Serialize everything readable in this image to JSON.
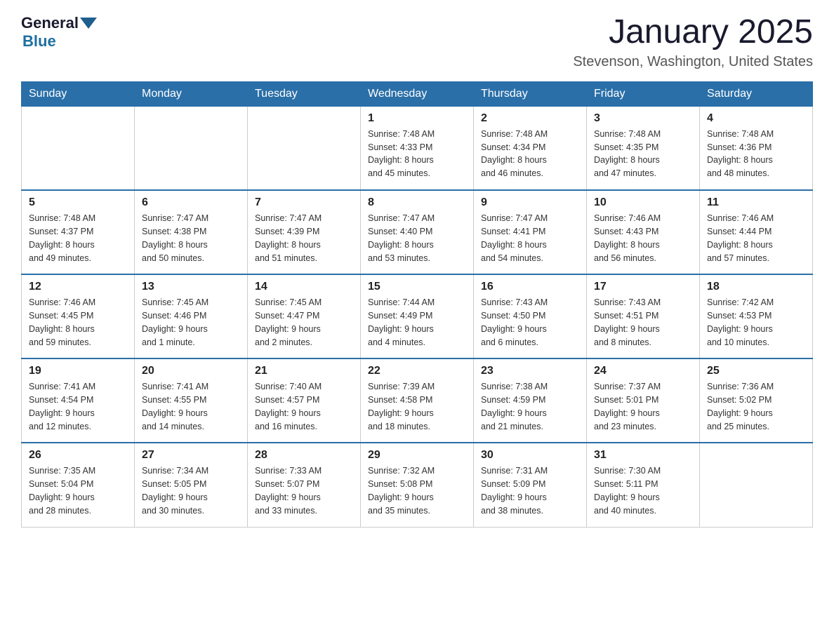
{
  "logo": {
    "general": "General",
    "blue": "Blue"
  },
  "title": "January 2025",
  "location": "Stevenson, Washington, United States",
  "days_of_week": [
    "Sunday",
    "Monday",
    "Tuesday",
    "Wednesday",
    "Thursday",
    "Friday",
    "Saturday"
  ],
  "weeks": [
    [
      {
        "day": "",
        "info": ""
      },
      {
        "day": "",
        "info": ""
      },
      {
        "day": "",
        "info": ""
      },
      {
        "day": "1",
        "info": "Sunrise: 7:48 AM\nSunset: 4:33 PM\nDaylight: 8 hours\nand 45 minutes."
      },
      {
        "day": "2",
        "info": "Sunrise: 7:48 AM\nSunset: 4:34 PM\nDaylight: 8 hours\nand 46 minutes."
      },
      {
        "day": "3",
        "info": "Sunrise: 7:48 AM\nSunset: 4:35 PM\nDaylight: 8 hours\nand 47 minutes."
      },
      {
        "day": "4",
        "info": "Sunrise: 7:48 AM\nSunset: 4:36 PM\nDaylight: 8 hours\nand 48 minutes."
      }
    ],
    [
      {
        "day": "5",
        "info": "Sunrise: 7:48 AM\nSunset: 4:37 PM\nDaylight: 8 hours\nand 49 minutes."
      },
      {
        "day": "6",
        "info": "Sunrise: 7:47 AM\nSunset: 4:38 PM\nDaylight: 8 hours\nand 50 minutes."
      },
      {
        "day": "7",
        "info": "Sunrise: 7:47 AM\nSunset: 4:39 PM\nDaylight: 8 hours\nand 51 minutes."
      },
      {
        "day": "8",
        "info": "Sunrise: 7:47 AM\nSunset: 4:40 PM\nDaylight: 8 hours\nand 53 minutes."
      },
      {
        "day": "9",
        "info": "Sunrise: 7:47 AM\nSunset: 4:41 PM\nDaylight: 8 hours\nand 54 minutes."
      },
      {
        "day": "10",
        "info": "Sunrise: 7:46 AM\nSunset: 4:43 PM\nDaylight: 8 hours\nand 56 minutes."
      },
      {
        "day": "11",
        "info": "Sunrise: 7:46 AM\nSunset: 4:44 PM\nDaylight: 8 hours\nand 57 minutes."
      }
    ],
    [
      {
        "day": "12",
        "info": "Sunrise: 7:46 AM\nSunset: 4:45 PM\nDaylight: 8 hours\nand 59 minutes."
      },
      {
        "day": "13",
        "info": "Sunrise: 7:45 AM\nSunset: 4:46 PM\nDaylight: 9 hours\nand 1 minute."
      },
      {
        "day": "14",
        "info": "Sunrise: 7:45 AM\nSunset: 4:47 PM\nDaylight: 9 hours\nand 2 minutes."
      },
      {
        "day": "15",
        "info": "Sunrise: 7:44 AM\nSunset: 4:49 PM\nDaylight: 9 hours\nand 4 minutes."
      },
      {
        "day": "16",
        "info": "Sunrise: 7:43 AM\nSunset: 4:50 PM\nDaylight: 9 hours\nand 6 minutes."
      },
      {
        "day": "17",
        "info": "Sunrise: 7:43 AM\nSunset: 4:51 PM\nDaylight: 9 hours\nand 8 minutes."
      },
      {
        "day": "18",
        "info": "Sunrise: 7:42 AM\nSunset: 4:53 PM\nDaylight: 9 hours\nand 10 minutes."
      }
    ],
    [
      {
        "day": "19",
        "info": "Sunrise: 7:41 AM\nSunset: 4:54 PM\nDaylight: 9 hours\nand 12 minutes."
      },
      {
        "day": "20",
        "info": "Sunrise: 7:41 AM\nSunset: 4:55 PM\nDaylight: 9 hours\nand 14 minutes."
      },
      {
        "day": "21",
        "info": "Sunrise: 7:40 AM\nSunset: 4:57 PM\nDaylight: 9 hours\nand 16 minutes."
      },
      {
        "day": "22",
        "info": "Sunrise: 7:39 AM\nSunset: 4:58 PM\nDaylight: 9 hours\nand 18 minutes."
      },
      {
        "day": "23",
        "info": "Sunrise: 7:38 AM\nSunset: 4:59 PM\nDaylight: 9 hours\nand 21 minutes."
      },
      {
        "day": "24",
        "info": "Sunrise: 7:37 AM\nSunset: 5:01 PM\nDaylight: 9 hours\nand 23 minutes."
      },
      {
        "day": "25",
        "info": "Sunrise: 7:36 AM\nSunset: 5:02 PM\nDaylight: 9 hours\nand 25 minutes."
      }
    ],
    [
      {
        "day": "26",
        "info": "Sunrise: 7:35 AM\nSunset: 5:04 PM\nDaylight: 9 hours\nand 28 minutes."
      },
      {
        "day": "27",
        "info": "Sunrise: 7:34 AM\nSunset: 5:05 PM\nDaylight: 9 hours\nand 30 minutes."
      },
      {
        "day": "28",
        "info": "Sunrise: 7:33 AM\nSunset: 5:07 PM\nDaylight: 9 hours\nand 33 minutes."
      },
      {
        "day": "29",
        "info": "Sunrise: 7:32 AM\nSunset: 5:08 PM\nDaylight: 9 hours\nand 35 minutes."
      },
      {
        "day": "30",
        "info": "Sunrise: 7:31 AM\nSunset: 5:09 PM\nDaylight: 9 hours\nand 38 minutes."
      },
      {
        "day": "31",
        "info": "Sunrise: 7:30 AM\nSunset: 5:11 PM\nDaylight: 9 hours\nand 40 minutes."
      },
      {
        "day": "",
        "info": ""
      }
    ]
  ]
}
